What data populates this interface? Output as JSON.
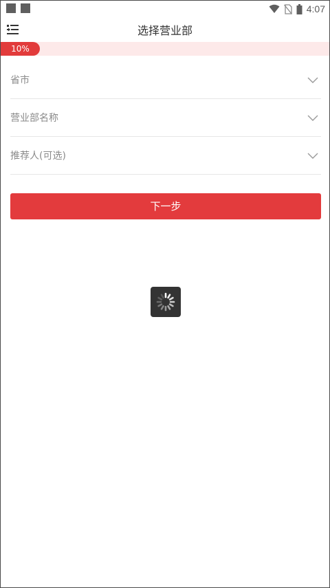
{
  "status_bar": {
    "time": "4:07",
    "icons": [
      "notification-square-icon",
      "notification-square-icon",
      "wifi-icon",
      "no-sim-icon",
      "battery-icon"
    ]
  },
  "header": {
    "title": "选择营业部",
    "menu_icon": "menu-icon"
  },
  "progress": {
    "label": "10%",
    "value": 0.1,
    "fill_color": "#e23b3b",
    "track_color": "#fde9e9"
  },
  "form": {
    "fields": [
      {
        "label": "省市",
        "icon": "chevron-down-icon"
      },
      {
        "label": "营业部名称",
        "icon": "chevron-down-icon"
      },
      {
        "label": "推荐人(可选)",
        "icon": "chevron-down-icon"
      }
    ]
  },
  "actions": {
    "next_label": "下一步",
    "accent_color": "#e33b3d"
  },
  "overlay": {
    "spinner_icon": "loading-spinner-icon"
  }
}
